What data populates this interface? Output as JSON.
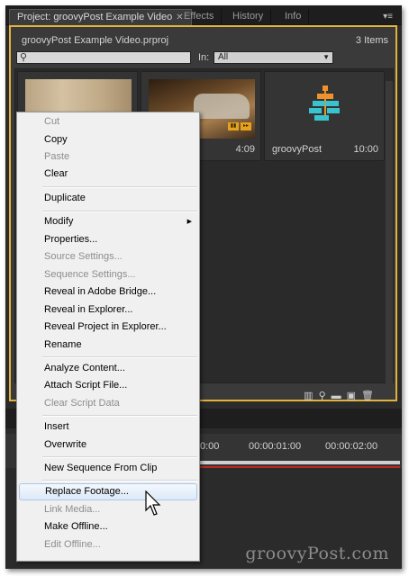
{
  "tabs": [
    {
      "label": "Project: groovyPost Example Video",
      "active": true
    },
    {
      "label": "Effects",
      "active": false
    },
    {
      "label": "History",
      "active": false
    },
    {
      "label": "Info",
      "active": false
    }
  ],
  "panel_menu_icon": "menu-icon",
  "project": {
    "name": "groovyPost Example Video.prproj",
    "item_count": "3 Items",
    "search_value": "",
    "in_label": "In:",
    "in_value": "All",
    "items": [
      {
        "name": "",
        "duration": ""
      },
      {
        "name": "o4",
        "duration": "4:09"
      },
      {
        "name": "groovyPost",
        "duration": "10:00"
      }
    ]
  },
  "timeline": {
    "timecodes": [
      "0:00",
      "00:00:01:00",
      "00:00:02:00"
    ]
  },
  "context_menu": {
    "cut": "Cut",
    "copy": "Copy",
    "paste": "Paste",
    "clear": "Clear",
    "duplicate": "Duplicate",
    "modify": "Modify",
    "properties": "Properties...",
    "source_settings": "Source Settings...",
    "sequence_settings": "Sequence Settings...",
    "reveal_bridge": "Reveal in Adobe Bridge...",
    "reveal_explorer": "Reveal in Explorer...",
    "reveal_project": "Reveal Project in Explorer...",
    "rename": "Rename",
    "analyze": "Analyze Content...",
    "attach_script": "Attach Script File...",
    "clear_script": "Clear Script Data",
    "insert": "Insert",
    "overwrite": "Overwrite",
    "new_sequence": "New Sequence From Clip",
    "replace_footage": "Replace Footage...",
    "link_media": "Link Media...",
    "make_offline": "Make Offline...",
    "edit_offline": "Edit Offline..."
  },
  "watermark": "groovyPost.com",
  "colors": {
    "panel_border": "#e2b33c",
    "sequence_orange": "#f0922b",
    "sequence_cyan": "#39c3cf"
  }
}
